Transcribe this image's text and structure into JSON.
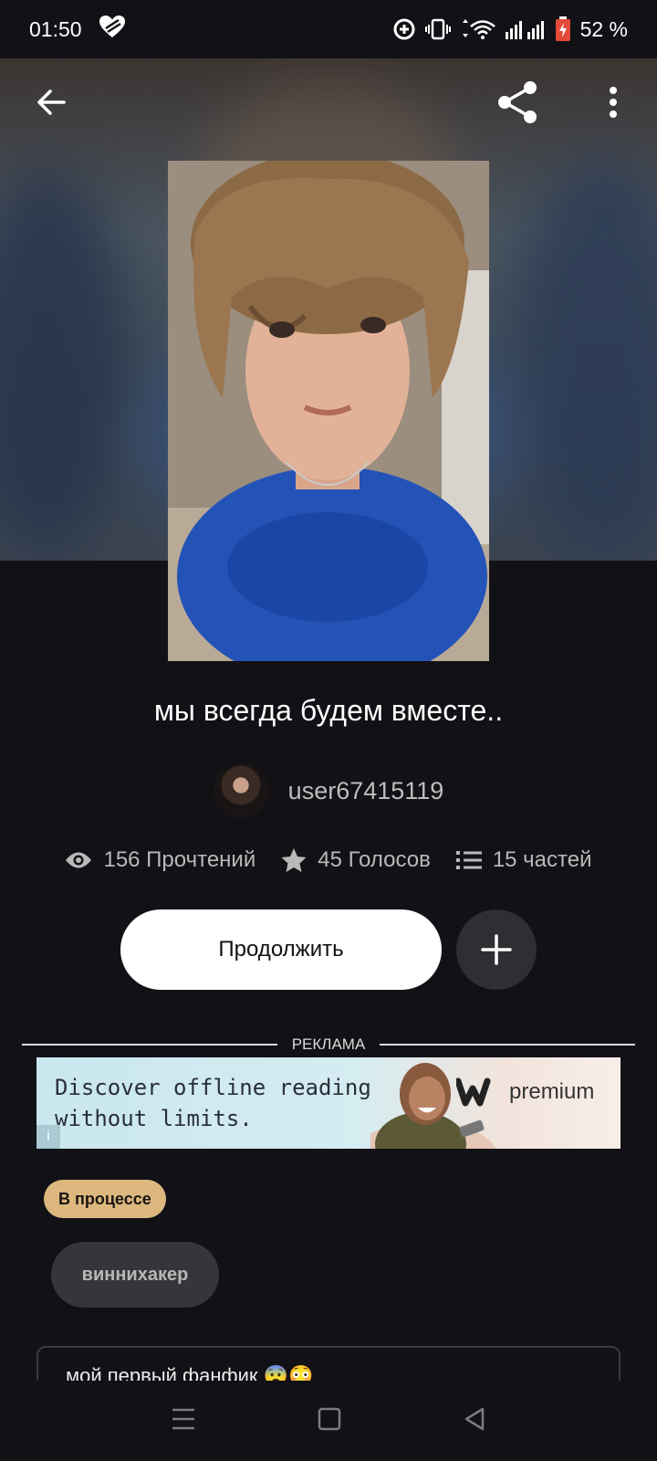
{
  "status_bar": {
    "time": "01:50",
    "battery": "52 %"
  },
  "story": {
    "title": "мы всегда будем вместе..",
    "author": "user67415119"
  },
  "stats": {
    "reads": "156 Прочтений",
    "votes": "45 Голосов",
    "parts": "15 частей"
  },
  "actions": {
    "continue_label": "Продолжить"
  },
  "ad": {
    "label": "РЕКЛАМА",
    "line1": "Discover offline reading",
    "line2": "without limits.",
    "brand": "premium"
  },
  "status_badge": "В процессе",
  "tags": [
    "виннихакер"
  ],
  "description": "мой первый фанфик 😨😳",
  "colors": {
    "background": "#121116",
    "badge": "#dcb87f",
    "tag_bg": "#36353a"
  }
}
